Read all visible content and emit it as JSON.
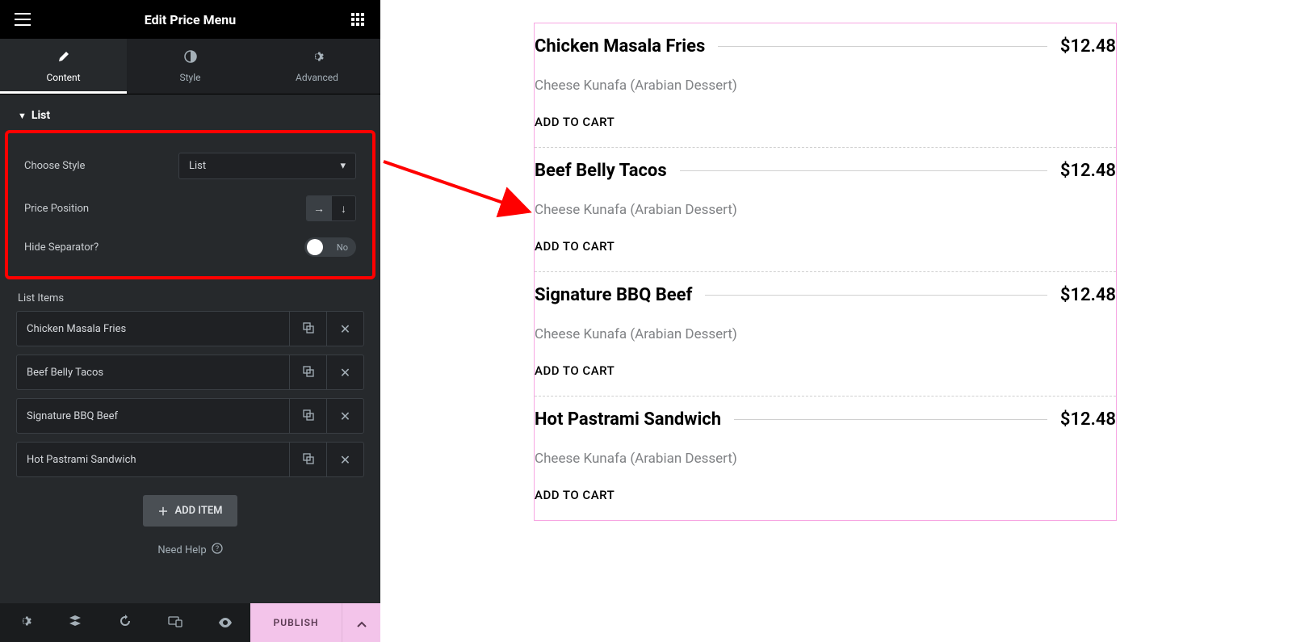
{
  "header": {
    "title": "Edit Price Menu"
  },
  "tabs": [
    {
      "label": "Content",
      "icon": "pencil"
    },
    {
      "label": "Style",
      "icon": "contrast"
    },
    {
      "label": "Advanced",
      "icon": "gear"
    }
  ],
  "section": {
    "title": "List"
  },
  "controls": {
    "choose_style": {
      "label": "Choose Style",
      "value": "List"
    },
    "price_position": {
      "label": "Price Position"
    },
    "hide_separator": {
      "label": "Hide Separator?",
      "value": "No"
    }
  },
  "list_items_label": "List Items",
  "list_items": [
    {
      "label": "Chicken Masala Fries"
    },
    {
      "label": "Beef Belly Tacos"
    },
    {
      "label": "Signature BBQ Beef"
    },
    {
      "label": "Hot Pastrami Sandwich"
    }
  ],
  "add_item_label": "ADD ITEM",
  "need_help": "Need Help",
  "publish": "PUBLISH",
  "preview": {
    "items": [
      {
        "title": "Chicken Masala Fries",
        "desc": "Cheese Kunafa (Arabian Dessert)",
        "price": "$12.48",
        "cart": "ADD TO CART"
      },
      {
        "title": "Beef Belly Tacos",
        "desc": "Cheese Kunafa (Arabian Dessert)",
        "price": "$12.48",
        "cart": "ADD TO CART"
      },
      {
        "title": "Signature BBQ Beef",
        "desc": "Cheese Kunafa (Arabian Dessert)",
        "price": "$12.48",
        "cart": "ADD TO CART"
      },
      {
        "title": "Hot Pastrami Sandwich",
        "desc": "Cheese Kunafa (Arabian Dessert)",
        "price": "$12.48",
        "cart": "ADD TO CART"
      }
    ]
  }
}
